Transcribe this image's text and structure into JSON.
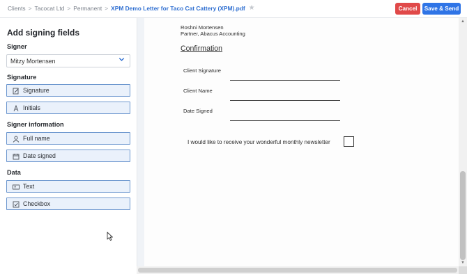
{
  "breadcrumb": {
    "items": [
      "Clients",
      "Tacocat Ltd",
      "Permanent"
    ],
    "separator": ">",
    "document": "XPM Demo Letter for Taco Cat Cattery (XPM).pdf"
  },
  "header": {
    "cancel_label": "Cancel",
    "save_send_label": "Save & Send"
  },
  "sidebar": {
    "title": "Add signing fields",
    "signer_heading": "Signer",
    "signer_value": "Mitzy Mortensen",
    "signature_heading": "Signature",
    "signature_fields": [
      {
        "label": "Signature",
        "icon": "signature-icon"
      },
      {
        "label": "Initials",
        "icon": "initials-icon"
      }
    ],
    "signer_info_heading": "Signer information",
    "signer_info_fields": [
      {
        "label": "Full name",
        "icon": "person-icon"
      },
      {
        "label": "Date signed",
        "icon": "calendar-icon"
      }
    ],
    "data_heading": "Data",
    "data_fields": [
      {
        "label": "Text",
        "icon": "text-field-icon"
      },
      {
        "label": "Checkbox",
        "icon": "checkbox-icon"
      }
    ]
  },
  "document": {
    "signatory_name": "Roshni Mortensen",
    "signatory_role": "Partner, Abacus Accounting",
    "confirmation_heading": "Confirmation",
    "field_labels": [
      "Client Signature",
      "Client Name",
      "Date Signed"
    ],
    "newsletter_text": "I would like to receive your wonderful monthly newsletter"
  },
  "colors": {
    "cancel": "#e04949",
    "save_send": "#2f74e6",
    "link": "#2f6fd1",
    "field_bg": "#eaf1fb",
    "field_border": "#6d97cf"
  }
}
